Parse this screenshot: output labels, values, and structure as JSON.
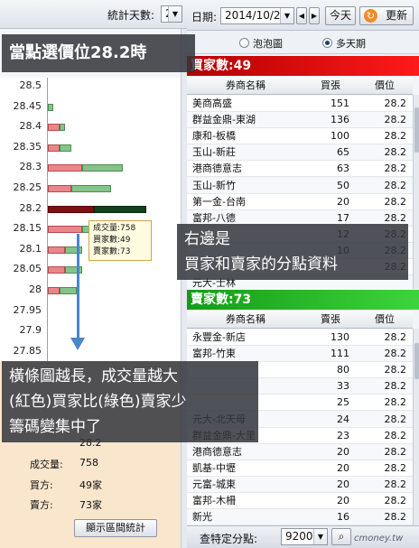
{
  "left_panel": {
    "days_label": "統計天數:",
    "days_value": "2",
    "ticks": [
      "28.5",
      "28.45",
      "28.4",
      "28.35",
      "28.3",
      "28.25",
      "28.2",
      "28.15",
      "28.1",
      "28.05",
      "28",
      "27.95",
      "27.9",
      "27.85"
    ],
    "tooltip": {
      "volume": "成交量:758",
      "buyers": "買家數:49",
      "sellers": "賣家數:73"
    },
    "summary": {
      "price_value": "28.2",
      "volume_label": "成交量:",
      "volume_value": "758",
      "buy_label": "買方:",
      "buy_value": "49家",
      "sell_label": "賣方:",
      "sell_value": "73家",
      "range_button": "顯示區間統計"
    }
  },
  "chart_data": {
    "type": "bar",
    "orientation": "horizontal",
    "categories": [
      "28.5",
      "28.45",
      "28.4",
      "28.35",
      "28.3",
      "28.25",
      "28.2",
      "28.15",
      "28.1",
      "28.05",
      "28",
      "27.95",
      "27.9",
      "27.85"
    ],
    "series": [
      {
        "name": "買家",
        "values": [
          0,
          0,
          4,
          4,
          12,
          8,
          16,
          12,
          6,
          6,
          4,
          0,
          0,
          0
        ]
      },
      {
        "name": "賣家",
        "values": [
          0,
          2,
          2,
          4,
          14,
          14,
          18,
          18,
          6,
          6,
          6,
          0,
          0,
          0
        ]
      }
    ],
    "selected_category": "28.2"
  },
  "right_panel": {
    "date_label": "日期:",
    "date_value": "2014/10/2",
    "today_button": "今天",
    "update_button": "更新",
    "radio_bubble": "泡泡圖",
    "radio_multiday": "多天期",
    "buy_section": {
      "title": "買家數:49",
      "headers": [
        "券商名稱",
        "買張",
        "價位"
      ],
      "rows": [
        {
          "broker": "美商高盛",
          "qty": "151",
          "price": "28.2"
        },
        {
          "broker": "群益金鼎-東湖",
          "qty": "136",
          "price": "28.2"
        },
        {
          "broker": "康和-板橋",
          "qty": "100",
          "price": "28.2"
        },
        {
          "broker": "玉山-新莊",
          "qty": "65",
          "price": "28.2"
        },
        {
          "broker": "港商德意志",
          "qty": "63",
          "price": "28.2"
        },
        {
          "broker": "玉山-新竹",
          "qty": "50",
          "price": "28.2"
        },
        {
          "broker": "第一金-台南",
          "qty": "20",
          "price": "28.2"
        },
        {
          "broker": "富邦-八德",
          "qty": "17",
          "price": "28.2"
        },
        {
          "broker": "",
          "qty": "12",
          "price": "28.2"
        },
        {
          "broker": "",
          "qty": "10",
          "price": "28.2"
        },
        {
          "broker": "",
          "qty": "",
          "price": "28.2"
        },
        {
          "broker": "元大-士林",
          "qty": "",
          "price": ""
        }
      ]
    },
    "sell_section": {
      "title": "賣家數:73",
      "headers": [
        "券商名稱",
        "賣張",
        "價位"
      ],
      "rows": [
        {
          "broker": "永豐金-新店",
          "qty": "130",
          "price": "28.2"
        },
        {
          "broker": "富邦-竹東",
          "qty": "111",
          "price": "28.2"
        },
        {
          "broker": "",
          "qty": "80",
          "price": "28.2"
        },
        {
          "broker": "",
          "qty": "33",
          "price": "28.2"
        },
        {
          "broker": "",
          "qty": "25",
          "price": "28.2"
        },
        {
          "broker": "元大-北天母",
          "qty": "24",
          "price": "28.2"
        },
        {
          "broker": "群益金鼎-大里",
          "qty": "23",
          "price": "28.2"
        },
        {
          "broker": "港商德意志",
          "qty": "20",
          "price": "28.2"
        },
        {
          "broker": "凱基-中壢",
          "qty": "20",
          "price": "28.2"
        },
        {
          "broker": "元富-城東",
          "qty": "20",
          "price": "28.2"
        },
        {
          "broker": "富邦-木柵",
          "qty": "20",
          "price": "28.2"
        },
        {
          "broker": "新光",
          "qty": "16",
          "price": "28.2"
        }
      ]
    },
    "bottom": {
      "label": "查特定分點:",
      "value": "9200"
    }
  },
  "overlays": {
    "top": "當點選價位28.2時",
    "right_line1": "右邊是",
    "right_line2": "買家和賣家的分點資料",
    "bottom_line1": "橫條圖越長，成交量越大",
    "bottom_line2": "(紅色)買家比(綠色)賣家少",
    "bottom_line3": "籌碼變集中了"
  },
  "watermark": "cmoney.tw",
  "colors": {
    "buy_header": "#d00000",
    "sell_header": "#22b522",
    "buy_bar": "#e8878a",
    "sell_bar": "#86c38a",
    "summary_bg": "#fae6cd"
  }
}
